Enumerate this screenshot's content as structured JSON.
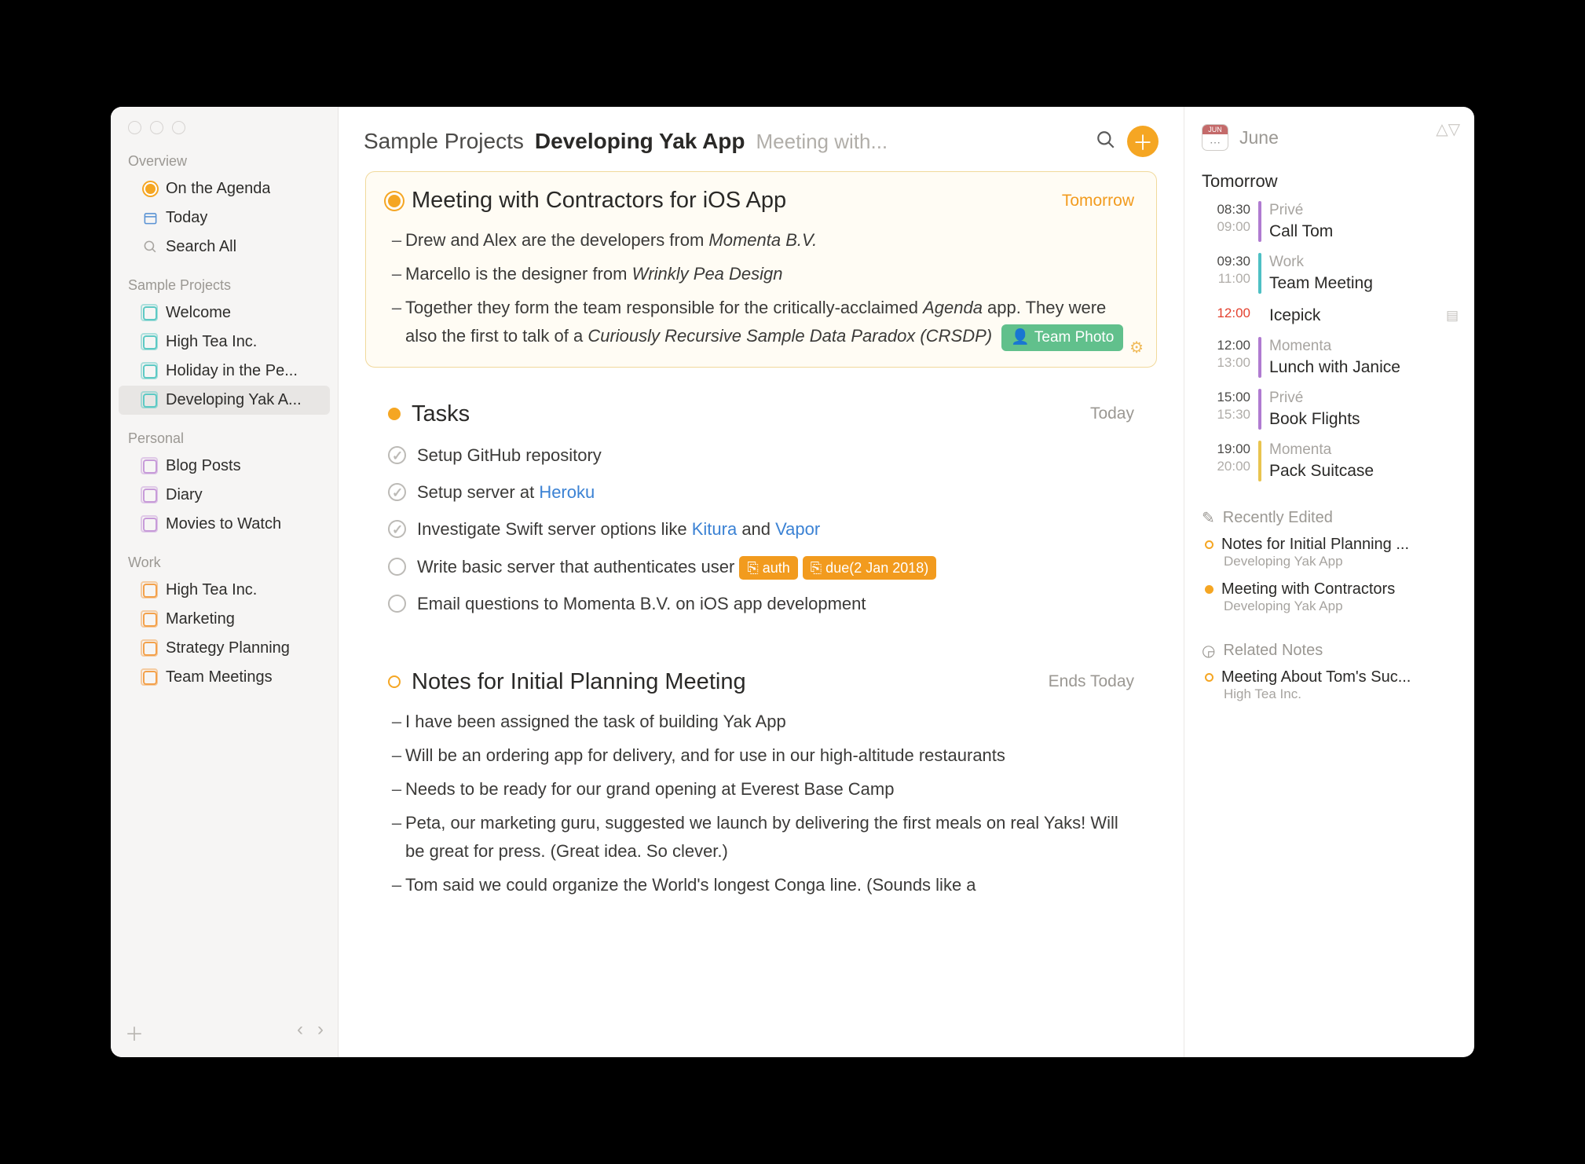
{
  "sidebar": {
    "overview_title": "Overview",
    "overview": [
      {
        "icon": "agenda-dot",
        "label": "On the Agenda"
      },
      {
        "icon": "today",
        "label": "Today"
      },
      {
        "icon": "search",
        "label": "Search All"
      }
    ],
    "sections": [
      {
        "title": "Sample Projects",
        "color": "teal",
        "items": [
          {
            "label": "Welcome"
          },
          {
            "label": "High Tea Inc."
          },
          {
            "label": "Holiday in the Pe..."
          },
          {
            "label": "Developing Yak A...",
            "selected": true
          }
        ]
      },
      {
        "title": "Personal",
        "color": "purple",
        "items": [
          {
            "label": "Blog Posts"
          },
          {
            "label": "Diary"
          },
          {
            "label": "Movies to Watch"
          }
        ]
      },
      {
        "title": "Work",
        "color": "orange",
        "items": [
          {
            "label": "High Tea Inc."
          },
          {
            "label": "Marketing"
          },
          {
            "label": "Strategy Planning"
          },
          {
            "label": "Team Meetings"
          }
        ]
      }
    ]
  },
  "header": {
    "category": "Sample Projects",
    "project": "Developing Yak App",
    "extra": "Meeting with..."
  },
  "notes": [
    {
      "id": "meeting",
      "dot": "filled",
      "highlight": true,
      "title": "Meeting with Contractors for iOS App",
      "date": "Tomorrow",
      "date_style": "orange",
      "bullets": [
        {
          "pre": "Drew and Alex are the developers from ",
          "em": "Momenta B.V.",
          "post": ""
        },
        {
          "pre": "Marcello is the designer from ",
          "em": "Wrinkly Pea Design",
          "post": ""
        },
        {
          "pre": "Together they form the team responsible for the critically-acclaimed ",
          "em": "Agenda",
          "post": " app. They were also the first to talk of a ",
          "em2": "Curiously Recursive Sample Data Paradox (CRSDP)",
          "tag": "Team Photo"
        }
      ]
    },
    {
      "id": "tasks",
      "dot": "solid",
      "title": "Tasks",
      "date": "Today",
      "date_style": "gray",
      "tasks": [
        {
          "done": true,
          "text": "Setup GitHub repository"
        },
        {
          "done": true,
          "text": "Setup server at ",
          "link": "Heroku"
        },
        {
          "done": true,
          "text": "Investigate Swift server options like ",
          "link": "Kitura",
          "mid": " and ",
          "link2": "Vapor"
        },
        {
          "done": false,
          "text": "Write basic server that authenticates user",
          "badges": [
            "auth",
            "due(2 Jan 2018)"
          ]
        },
        {
          "done": false,
          "text": "Email questions to Momenta B.V. on iOS app development"
        }
      ]
    },
    {
      "id": "planning",
      "dot": "open",
      "title": "Notes for Initial Planning Meeting",
      "date": "Ends Today",
      "date_style": "gray",
      "bullets": [
        {
          "pre": "I have been assigned the task of building Yak App"
        },
        {
          "pre": "Will be an ordering app for delivery, and for use in our high-altitude restaurants"
        },
        {
          "pre": "Needs to be ready for our grand opening at Everest Base Camp"
        },
        {
          "pre": "Peta, our marketing guru, suggested we launch by delivering the first meals on real Yaks! Will be great for press. (Great idea. So clever.)"
        },
        {
          "pre": "Tom said we could organize the World's longest Conga line. (Sounds like a"
        }
      ]
    }
  ],
  "aside": {
    "month_short": "JUN",
    "month": "June",
    "subhead": "Tomorrow",
    "events": [
      {
        "t1": "08:30",
        "t2": "09:00",
        "bar": "purple",
        "cal": "Privé",
        "title": "Call Tom"
      },
      {
        "t1": "09:30",
        "t2": "11:00",
        "bar": "teal",
        "cal": "Work",
        "title": "Team Meeting"
      },
      {
        "t1": "12:00",
        "t1red": true,
        "bar": "none",
        "title": "Icepick",
        "noteic": true
      },
      {
        "t1": "12:00",
        "t2": "13:00",
        "bar": "purple",
        "cal": "Momenta",
        "title": "Lunch with Janice"
      },
      {
        "t1": "15:00",
        "t2": "15:30",
        "bar": "purple",
        "cal": "Privé",
        "title": "Book Flights"
      },
      {
        "t1": "19:00",
        "t2": "20:00",
        "bar": "yellow",
        "cal": "Momenta",
        "title": "Pack Suitcase"
      }
    ],
    "recent_title": "Recently Edited",
    "recent": [
      {
        "dot": "open",
        "title": "Notes for Initial Planning ...",
        "sub": "Developing Yak App"
      },
      {
        "dot": "solid",
        "title": "Meeting with Contractors",
        "sub": "Developing Yak App"
      }
    ],
    "related_title": "Related Notes",
    "related": [
      {
        "dot": "open",
        "title": "Meeting About Tom's Suc...",
        "sub": "High Tea Inc."
      }
    ]
  }
}
